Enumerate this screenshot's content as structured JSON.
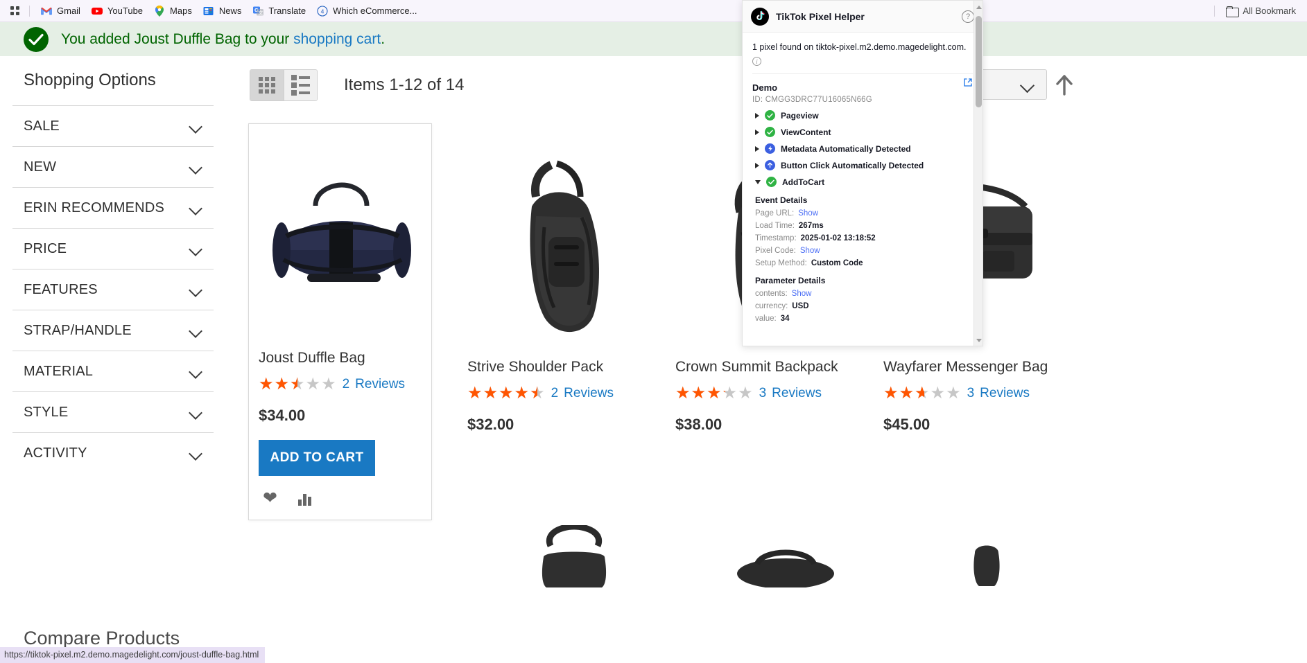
{
  "browser": {
    "apps_icon": "apps-grid-icon",
    "bookmarks": [
      {
        "label": "Gmail",
        "icon": "gmail-icon"
      },
      {
        "label": "YouTube",
        "icon": "youtube-icon"
      },
      {
        "label": "Maps",
        "icon": "maps-icon"
      },
      {
        "label": "News",
        "icon": "news-icon"
      },
      {
        "label": "Translate",
        "icon": "translate-icon"
      },
      {
        "label": "Which eCommerce...",
        "icon": "circle-4-icon"
      }
    ],
    "all_bookmarks_label": "All Bookmark",
    "status_url": "https://tiktok-pixel.m2.demo.magedelight.com/joust-duffle-bag.html"
  },
  "banner": {
    "text_before": "You added ",
    "product": "Joust Duffle Bag",
    "text_middle": " to your ",
    "link": "shopping cart",
    "text_after": ".",
    "icon": "check-circle-icon",
    "bg_color": "#e5efe5",
    "text_color": "#006400"
  },
  "sidebar": {
    "title": "Shopping Options",
    "filters": [
      {
        "label": "SALE"
      },
      {
        "label": "NEW"
      },
      {
        "label": "ERIN RECOMMENDS"
      },
      {
        "label": "PRICE"
      },
      {
        "label": "FEATURES"
      },
      {
        "label": "STRAP/HANDLE"
      },
      {
        "label": "MATERIAL"
      },
      {
        "label": "STYLE"
      },
      {
        "label": "ACTIVITY"
      }
    ],
    "compare_title": "Compare Products"
  },
  "toolbar": {
    "grid_view_icon": "grid-view-icon",
    "list_view_icon": "list-view-icon",
    "items_count": "Items 1-12 of 14",
    "sort_direction_icon": "sort-ascending-arrow-icon"
  },
  "products": [
    {
      "name": "Joust Duffle Bag",
      "rating_percent": 50,
      "reviews_count": "2",
      "reviews_label": "Reviews",
      "price": "$34.00",
      "add_to_cart": "ADD TO CART",
      "wishlist_icon": "heart-icon",
      "compare_icon": "compare-bars-icon",
      "featured": true
    },
    {
      "name": "Strive Shoulder Pack",
      "rating_percent": 90,
      "reviews_count": "2",
      "reviews_label": "Reviews",
      "price": "$32.00",
      "featured": false
    },
    {
      "name": "Crown Summit Backpack",
      "rating_percent": 64,
      "reviews_count": "3",
      "reviews_label": "Reviews",
      "price": "$38.00",
      "featured": false
    },
    {
      "name": "Wayfarer Messenger Bag",
      "rating_percent": 52,
      "reviews_count": "3",
      "reviews_label": "Reviews",
      "price": "$45.00",
      "featured": false
    }
  ],
  "tiktok_panel": {
    "title": "TikTok Pixel Helper",
    "logo_icon": "tiktok-logo-icon",
    "help_icon": "help-circle-icon",
    "found_text": "1 pixel found on tiktok-pixel.m2.demo.magedelight.com.",
    "info_icon": "info-circle-icon",
    "pixel_name": "Demo",
    "external_link_icon": "external-link-icon",
    "id_label": "ID:",
    "id_value": "CMGG3DRC77U16065N66G",
    "events": [
      {
        "name": "Pageview",
        "badge": "ok",
        "expanded": false
      },
      {
        "name": "ViewContent",
        "badge": "ok",
        "expanded": false
      },
      {
        "name": "Metadata Automatically Detected",
        "badge": "auto",
        "expanded": false
      },
      {
        "name": "Button Click Automatically Detected",
        "badge": "auto",
        "expanded": false
      },
      {
        "name": "AddToCart",
        "badge": "ok",
        "expanded": true
      }
    ],
    "event_details_title": "Event Details",
    "event_details": [
      {
        "key": "Page URL:",
        "value": "Show",
        "is_link": true
      },
      {
        "key": "Load Time:",
        "value": "267ms",
        "is_link": false
      },
      {
        "key": "Timestamp:",
        "value": "2025-01-02 13:18:52",
        "is_link": false
      },
      {
        "key": "Pixel Code:",
        "value": "Show",
        "is_link": true
      },
      {
        "key": "Setup Method:",
        "value": "Custom Code",
        "is_link": false
      }
    ],
    "parameter_details_title": "Parameter Details",
    "parameter_details": [
      {
        "key": "contents:",
        "value": "Show",
        "is_link": true
      },
      {
        "key": "currency:",
        "value": "USD",
        "is_link": false
      },
      {
        "key": "value:",
        "value": "34",
        "is_link": false
      }
    ]
  }
}
